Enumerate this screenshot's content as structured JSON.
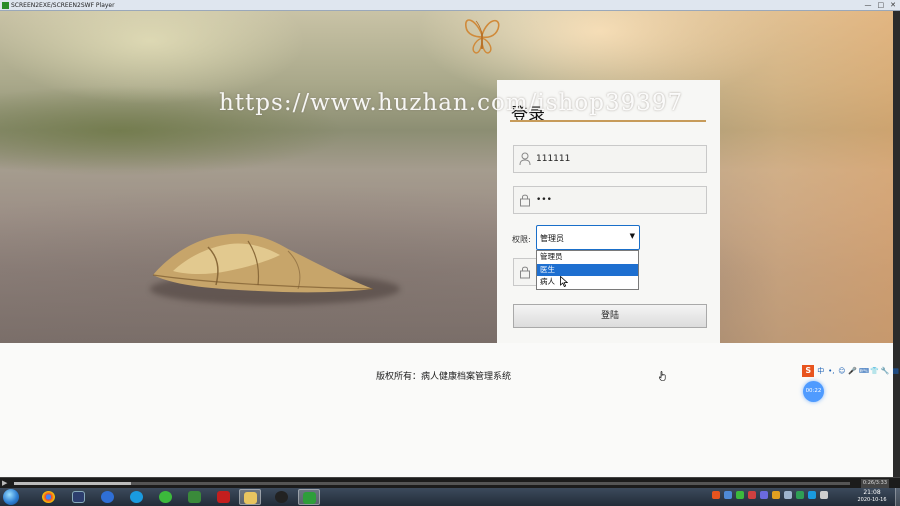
{
  "window": {
    "title": "SCREEN2EXE/SCREEN2SWF Player",
    "minimize_glyph": "—",
    "maximize_glyph": "□",
    "close_glyph": "✕"
  },
  "watermark": "https://www.huzhan.com/ishop39397",
  "login": {
    "title": "登录",
    "username_value": "111111",
    "password_value": "•••",
    "role_label": "权限:",
    "role_selected": "管理员",
    "role_options": [
      "管理员",
      "医生",
      "病人"
    ],
    "role_highlighted_index": 1,
    "login_button": "登陆"
  },
  "footer": {
    "copyright": "版权所有：病人健康档案管理系统"
  },
  "ime": {
    "logo": "S",
    "items": [
      "中",
      "•,",
      "☺",
      "🎤",
      "⌨",
      "👕",
      "🔧",
      "▦"
    ],
    "badge": "00:22"
  },
  "player": {
    "play_glyph": "▶",
    "progress": 0.14,
    "time": "0:26/3:33"
  },
  "taskbar": {
    "apps": [
      "chrome-icon",
      "media-icon",
      "baidu-icon",
      "qq-browser-icon",
      "360-icon",
      "chart-icon",
      "flash-icon",
      "folder-icon",
      "qq-icon",
      "screen2exe-icon"
    ],
    "clock_time": "21:08",
    "clock_date": "2020-10-16"
  },
  "colors": {
    "accent_underline": "#c79b5a",
    "select_highlight": "#1e6fd0",
    "ime_orange": "#e8541e"
  }
}
